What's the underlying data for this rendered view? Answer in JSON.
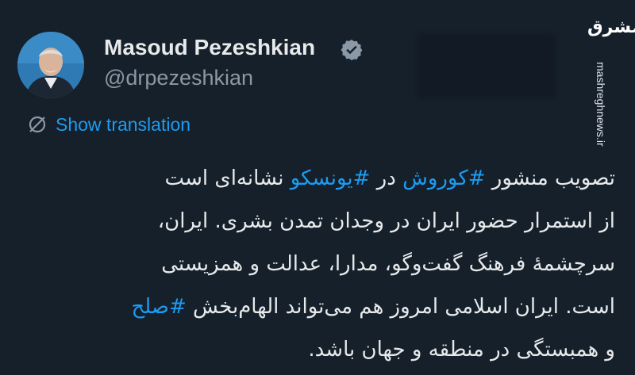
{
  "author": {
    "display_name": "Masoud Pezeshkian",
    "handle": "@drpezeshkian",
    "verified_icon": "verified-badge-icon"
  },
  "watermark": {
    "logo_text": "مشرق",
    "url": "mashreghnews.ir"
  },
  "translation": {
    "icon": "globe-slash-icon",
    "label": "Show translation"
  },
  "tweet": {
    "line1": {
      "a": "تصویب منشور ",
      "tag1": "#کوروش",
      "b": " در ",
      "tag2": "#یونسکو",
      "c": " نشانه‌ای است"
    },
    "line2": "از استمرار حضور ایران در وجدان تمدن بشری. ایران،",
    "line3": "سرچشمهٔ فرهنگ گفت‌وگو، مدارا، عدالت و همزیستی",
    "line4": {
      "a": "است. ایران اسلامی امروز هم می‌تواند الهام‌بخش ",
      "tag": "#صلح"
    },
    "line5": "و همبستگی در منطقه و جهان باشد."
  },
  "colors": {
    "background": "#15202b",
    "text": "#e7e9ea",
    "secondary": "#8b98a5",
    "accent": "#1d9bf0"
  }
}
